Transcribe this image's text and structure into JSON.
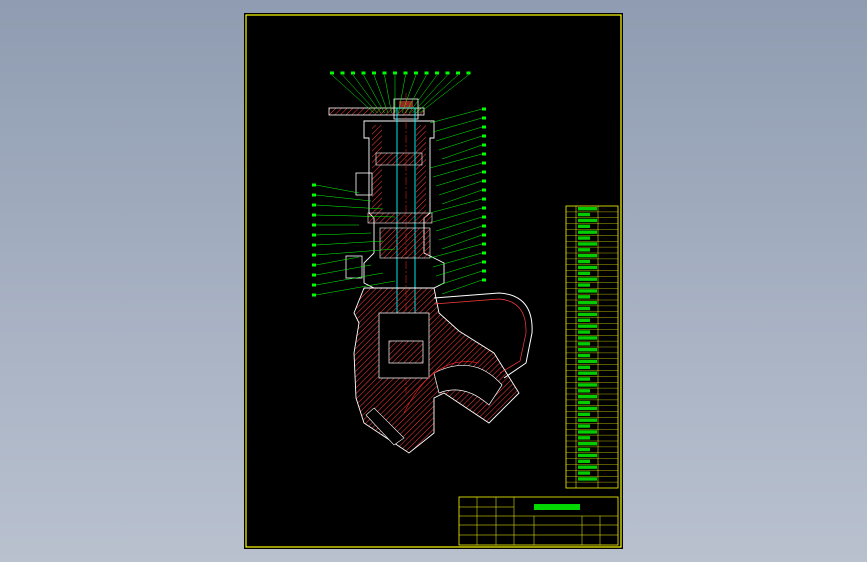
{
  "drawing": {
    "title": "",
    "colors": {
      "frame": "#ffff00",
      "outline": "#ffffff",
      "section": "#ff3b3b",
      "leader": "#00ff00",
      "center": "#ff2020",
      "hidden": "#00ffff",
      "bom": "#ffff00",
      "sheet": "#000000",
      "background": "#9aa6b9"
    },
    "views": [
      "valve-longitudinal-section"
    ],
    "balloon_count_top": 14,
    "balloon_count_left": 12,
    "balloon_count_right": 20
  },
  "bom": {
    "rows": 48
  },
  "title_block": {
    "drawing_name": "",
    "rows": 5
  }
}
